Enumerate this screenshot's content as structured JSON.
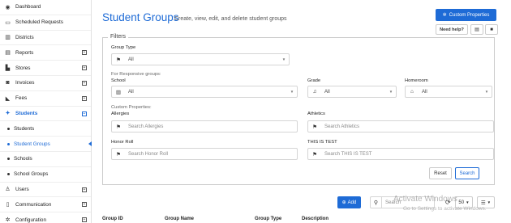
{
  "sidebar": {
    "items": [
      {
        "label": "Dashboard",
        "icon": "dashboard-icon"
      },
      {
        "label": "Scheduled Requests",
        "icon": "calendar-icon"
      },
      {
        "label": "Districts",
        "icon": "building-icon"
      },
      {
        "label": "Reports",
        "icon": "report-icon",
        "expand": "+"
      },
      {
        "label": "Stores",
        "icon": "cart-icon",
        "expand": "+"
      },
      {
        "label": "Invoices",
        "icon": "money-icon",
        "expand": "+"
      },
      {
        "label": "Fees",
        "icon": "hand-money-icon",
        "expand": "+"
      },
      {
        "label": "Students",
        "icon": "student-icon",
        "expand": "−"
      },
      {
        "label": "Students"
      },
      {
        "label": "Student Groups"
      },
      {
        "label": "Schools"
      },
      {
        "label": "School Groups"
      },
      {
        "label": "Users",
        "icon": "user-icon",
        "expand": "+"
      },
      {
        "label": "Communication",
        "icon": "document-icon",
        "expand": "+"
      },
      {
        "label": "Configuration",
        "icon": "gear-icon",
        "expand": "+"
      }
    ]
  },
  "header": {
    "title": "Student Groups",
    "subtitle": "Create, view, edit, and delete student groups",
    "custom_properties_label": "Custom Properties",
    "help_label": "Need help?"
  },
  "filters": {
    "legend": "Filters",
    "group_type_label": "Group Type",
    "group_type_value": "All",
    "responsive_note": "For Responsive groups:",
    "school_label": "School",
    "school_value": "All",
    "grade_label": "Grade",
    "grade_value": "All",
    "homeroom_label": "Homeroom",
    "homeroom_value": "All",
    "custom_props_note": "Custom Properties:",
    "allergies_label": "Allergies",
    "allergies_placeholder": "Search Allergies",
    "athletics_label": "Athletics",
    "athletics_placeholder": "Search Athletics",
    "honor_roll_label": "Honor Roll",
    "honor_roll_placeholder": "Search Honor Roll",
    "this_is_test_label": "THIS IS TEST",
    "this_is_test_placeholder": "Search THIS IS TEST",
    "reset_label": "Reset",
    "search_label": "Search"
  },
  "table": {
    "add_label": "Add",
    "search_placeholder": "Search",
    "page_size": "50",
    "columns": [
      "Group ID",
      "Group Name",
      "Group Type",
      "Description"
    ]
  },
  "watermark": {
    "line1": "Activate Windows",
    "line2": "Go to Settings to activate Windows."
  }
}
